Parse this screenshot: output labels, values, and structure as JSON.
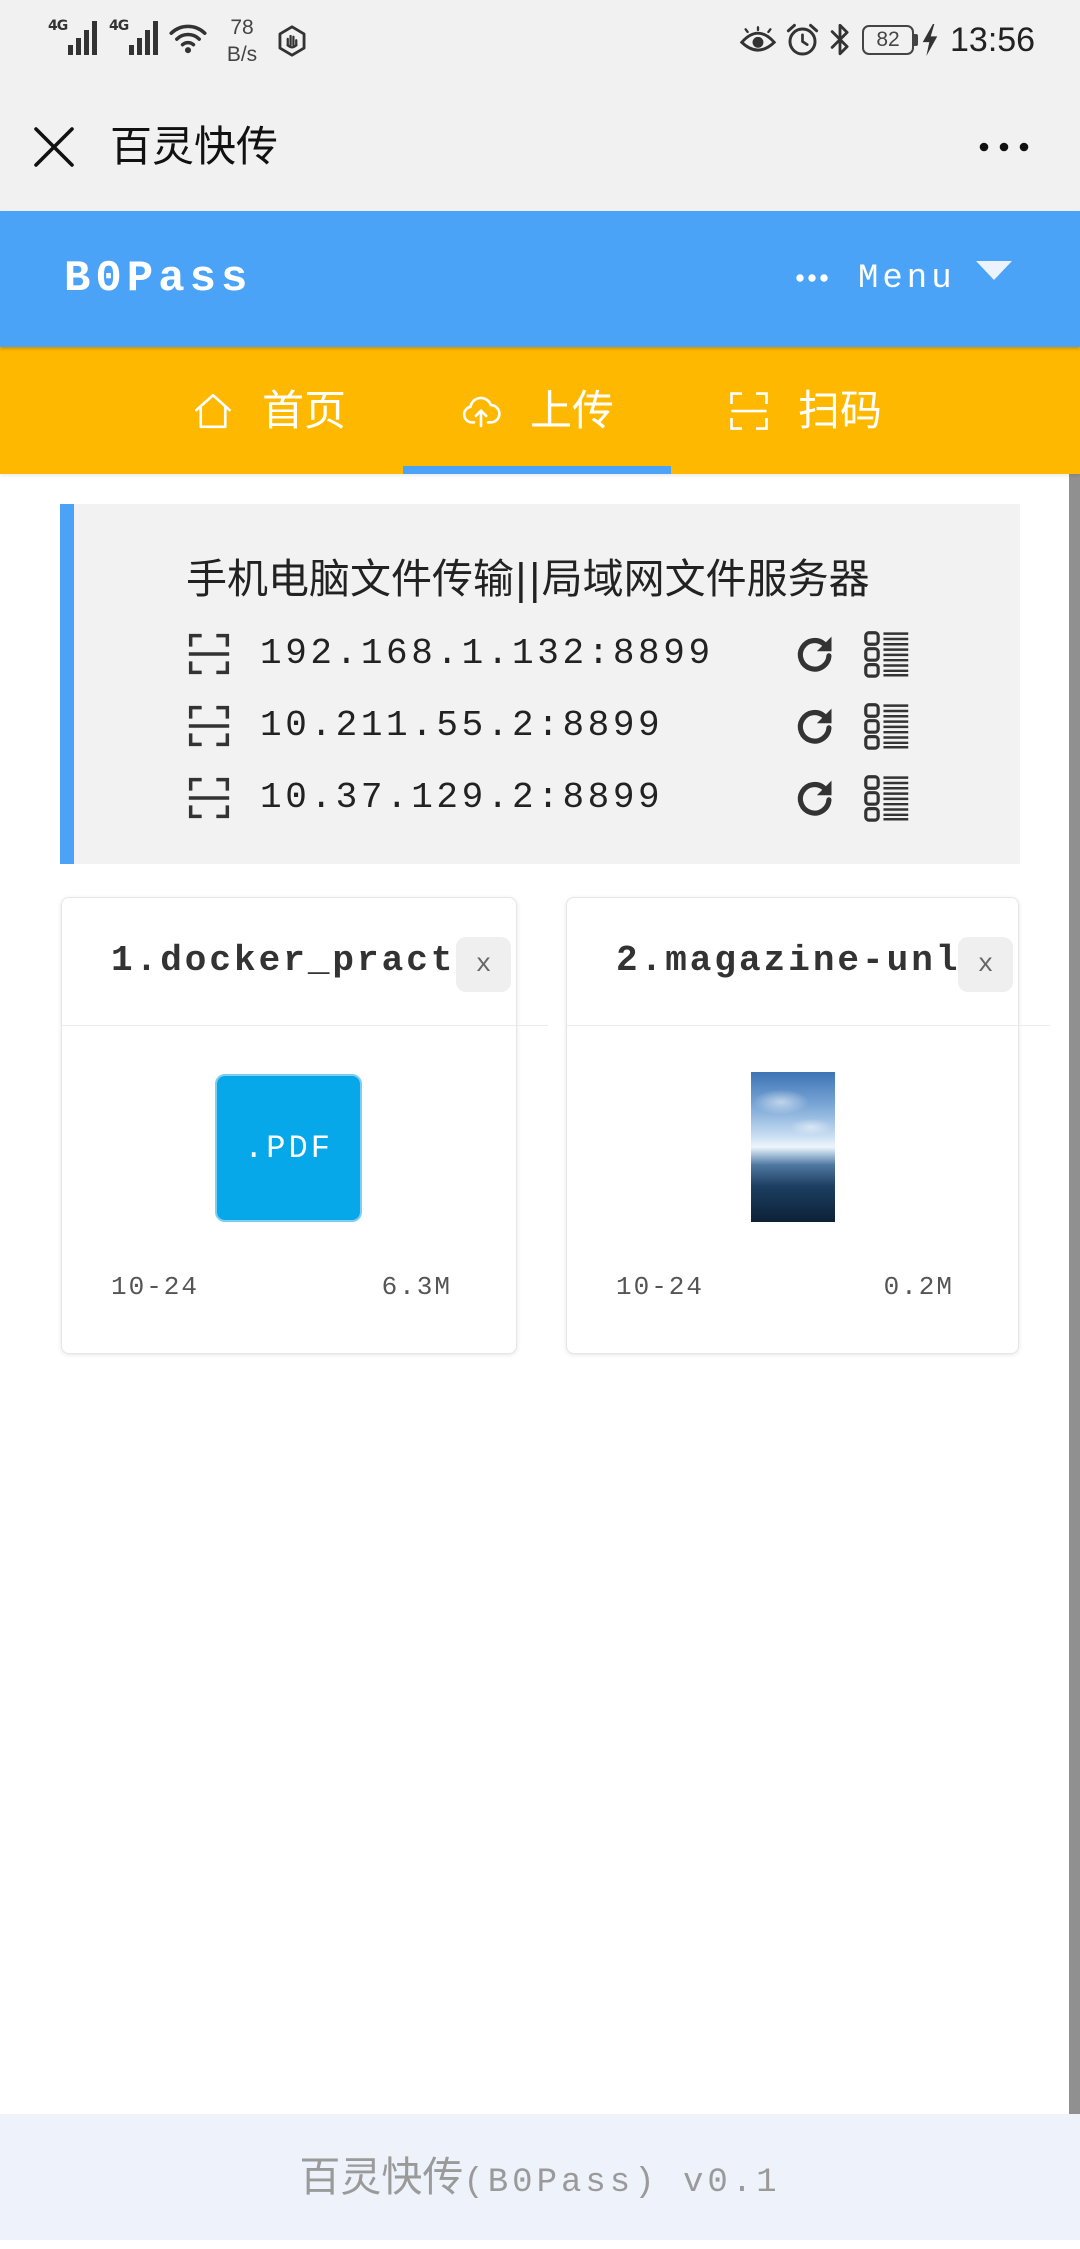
{
  "status_bar": {
    "left": {
      "sim1_network": "4G",
      "sim2_network": "4G",
      "net_speed_value": "78",
      "net_speed_unit": "B/s",
      "icons": [
        "signal-icon",
        "signal-icon",
        "wifi-icon",
        "hand-gesture-icon"
      ]
    },
    "right": {
      "battery_level": "82",
      "time": "13:56",
      "icons": [
        "eye-icon",
        "alarm-icon",
        "bluetooth-icon",
        "battery-icon",
        "charging-icon"
      ]
    }
  },
  "title_bar": {
    "title": "百灵快传",
    "close_icon": "close-icon",
    "more_icon": "more-icon"
  },
  "app_header": {
    "brand": "B0Pass",
    "menu_label": "Menu",
    "menu_icons": [
      "dots-icon",
      "caret-down-icon"
    ]
  },
  "nav": {
    "tabs": [
      {
        "label": "首页",
        "icon": "home-icon",
        "active": false
      },
      {
        "label": "上传",
        "icon": "upload-cloud-icon",
        "active": true
      },
      {
        "label": "扫码",
        "icon": "scan-icon",
        "active": false
      }
    ]
  },
  "server_info": {
    "title": "手机电脑文件传输||局域网文件服务器",
    "row_icons": [
      "scan-icon",
      "refresh-icon",
      "list-icon"
    ],
    "addresses": [
      {
        "address": "192.168.1.132:8899"
      },
      {
        "address": "10.211.55.2:8899"
      },
      {
        "address": "10.37.129.2:8899"
      }
    ]
  },
  "files": [
    {
      "name": "1.docker_pract",
      "thumbnail_icon": "pdf-thumbnail-icon",
      "thumbnail_label": ".PDF",
      "remove_label": "x",
      "date": "10-24",
      "size": "6.3M"
    },
    {
      "name": "2.magazine-unl",
      "thumbnail_icon": "image-thumbnail-icon",
      "remove_label": "x",
      "date": "10-24",
      "size": "0.2M"
    }
  ],
  "footer": {
    "app_name": "百灵快传",
    "version": "(B0Pass) v0.1"
  },
  "colors": {
    "brand_blue": "#4ba3f8",
    "nav_yellow": "#ffb800",
    "pdf_blue": "#06a8ea",
    "footer_bg": "#eef3fb"
  }
}
